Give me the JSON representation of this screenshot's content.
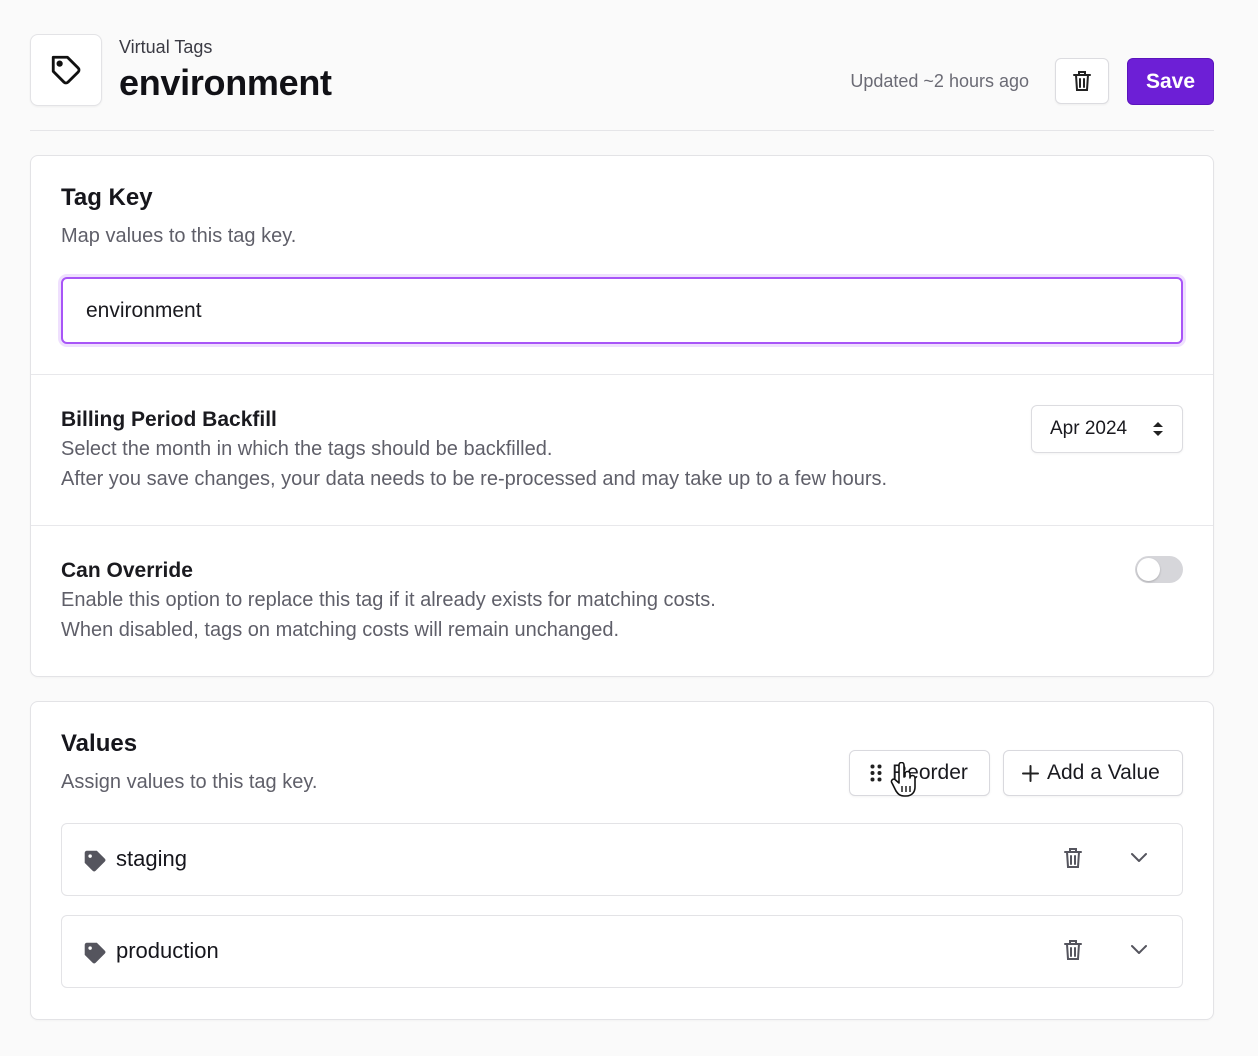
{
  "header": {
    "breadcrumb": "Virtual Tags",
    "title": "environment",
    "updated_text": "Updated ~2 hours ago",
    "save_label": "Save"
  },
  "tag_key": {
    "title": "Tag Key",
    "description": "Map values to this tag key.",
    "input_value": "environment"
  },
  "backfill": {
    "title": "Billing Period Backfill",
    "line1": "Select the month in which the tags should be backfilled.",
    "line2": "After you save changes, your data needs to be re-processed and may take up to a few hours.",
    "selected_month": "Apr 2024"
  },
  "override": {
    "title": "Can Override",
    "line1": "Enable this option to replace this tag if it already exists for matching costs.",
    "line2": "When disabled, tags on matching costs will remain unchanged.",
    "enabled": false
  },
  "values": {
    "title": "Values",
    "description": "Assign values to this tag key.",
    "reorder_label": "Reorder",
    "add_label": "Add a Value",
    "items": [
      {
        "label": "staging"
      },
      {
        "label": "production"
      }
    ]
  },
  "colors": {
    "accent": "#6d1fd6",
    "focus_ring": "#a855f7"
  }
}
